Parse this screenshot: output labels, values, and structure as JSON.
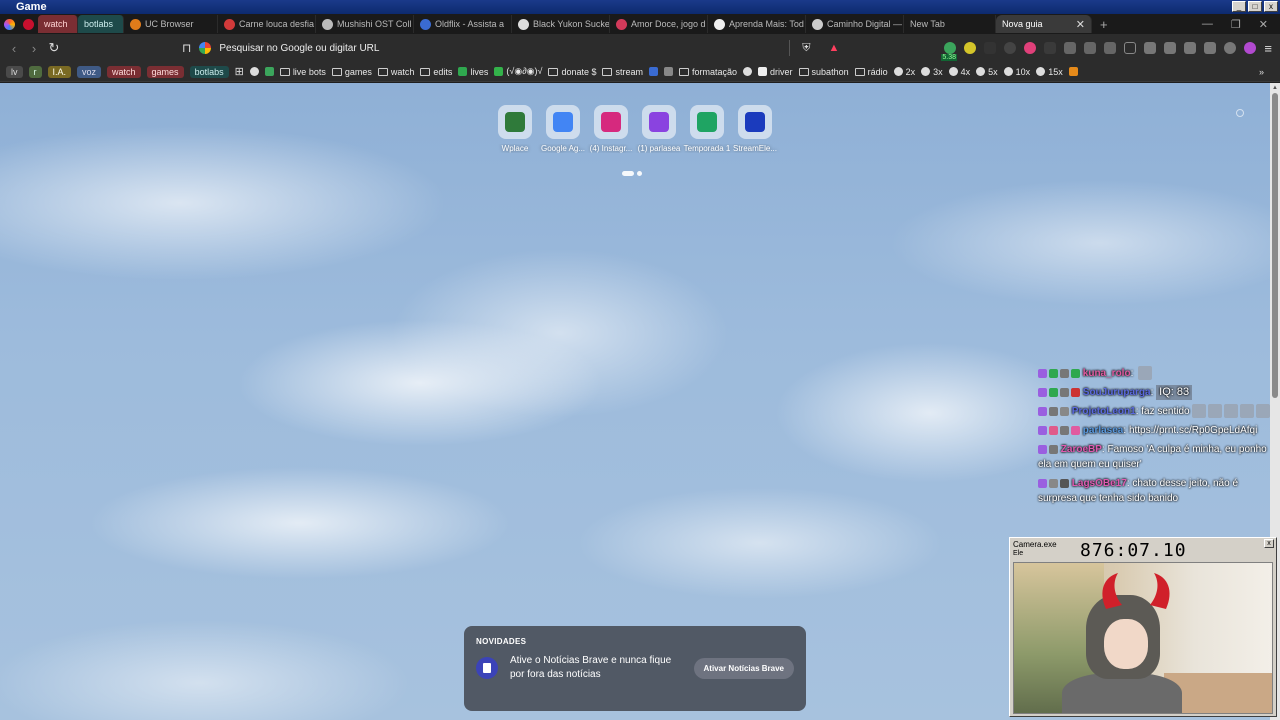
{
  "os": {
    "title": "Game",
    "controls": [
      "_",
      "□",
      "x"
    ]
  },
  "tabs": [
    {
      "label": "watch",
      "group": "watch",
      "favicon_color": "#7a2e33"
    },
    {
      "label": "botlabs",
      "group": "botlabs",
      "favicon_color": "#1e4a4a"
    },
    {
      "label": "UC Browser",
      "favicon_color": "#e07b1a"
    },
    {
      "label": "Carne louca desfia",
      "favicon_color": "#d23a3a"
    },
    {
      "label": "Mushishi OST Coll",
      "favicon_color": "#bbbbbb"
    },
    {
      "label": "Oldflix - Assista a",
      "favicon_color": "#3a6bd2"
    },
    {
      "label": "Black Yukon Sucke",
      "favicon_color": "#dddddd"
    },
    {
      "label": "Amor Doce, jogo d",
      "favicon_color": "#d23a5a"
    },
    {
      "label": "Aprenda Mais: Tod",
      "favicon_color": "#eeeeee"
    },
    {
      "label": "Caminho Digital —",
      "favicon_color": "#cccccc"
    },
    {
      "label": "New Tab",
      "favicon_color": ""
    },
    {
      "label": "Nova guia",
      "favicon_color": "",
      "active": true
    }
  ],
  "tab_close": "✕",
  "new_tab": "+",
  "window_controls": [
    "—",
    "❐",
    "✕"
  ],
  "toolbar": {
    "back": "‹",
    "forward": "›",
    "reload": "↻",
    "search_placeholder": "Pesquisar no Google ou digitar URL",
    "menu": "≡",
    "extension_badge": "5.38"
  },
  "bookmarks": [
    {
      "label": "lv",
      "type": "chip",
      "color": "gray"
    },
    {
      "label": "r",
      "type": "chip",
      "color": "green"
    },
    {
      "label": "I.A.",
      "type": "chip",
      "color": "yellow"
    },
    {
      "label": "voz",
      "type": "chip",
      "color": "blue"
    },
    {
      "label": "watch",
      "type": "chip",
      "color": "red"
    },
    {
      "label": "games",
      "type": "chip",
      "color": "red"
    },
    {
      "label": "botlabs",
      "type": "chip",
      "color": "teal"
    },
    {
      "label": "",
      "type": "grid"
    },
    {
      "label": "",
      "type": "globe"
    },
    {
      "label": "",
      "type": "square",
      "color": "#3ba55c"
    },
    {
      "label": "live bots",
      "type": "folder"
    },
    {
      "label": "games",
      "type": "folder"
    },
    {
      "label": "watch",
      "type": "folder"
    },
    {
      "label": "edits",
      "type": "folder"
    },
    {
      "label": "lives",
      "type": "square",
      "color": "#2fa84f"
    },
    {
      "label": "(√◉∂◉)√",
      "type": "square",
      "color": "#33b24a"
    },
    {
      "label": "donate $",
      "type": "folder"
    },
    {
      "label": "stream",
      "type": "folder"
    },
    {
      "label": "",
      "type": "square",
      "color": "#3a6bd2"
    },
    {
      "label": "",
      "type": "square",
      "color": "#888888"
    },
    {
      "label": "formatação",
      "type": "folder"
    },
    {
      "label": "",
      "type": "globe"
    },
    {
      "label": "driver",
      "type": "square",
      "color": "#eeeeee"
    },
    {
      "label": "subathon",
      "type": "folder"
    },
    {
      "label": "rádio",
      "type": "folder"
    },
    {
      "label": "2x",
      "type": "globe"
    },
    {
      "label": "3x",
      "type": "globe"
    },
    {
      "label": "4x",
      "type": "globe"
    },
    {
      "label": "5x",
      "type": "globe"
    },
    {
      "label": "10x",
      "type": "globe"
    },
    {
      "label": "15x",
      "type": "globe"
    },
    {
      "label": "",
      "type": "square",
      "color": "#e58a1a"
    }
  ],
  "bookmarks_more": "»",
  "top_sites": [
    {
      "label": "Wplace",
      "color": "#2f7a3a"
    },
    {
      "label": "Google Ag...",
      "color": "#4285f4"
    },
    {
      "label": "(4) Instagr...",
      "color": "#d6297e"
    },
    {
      "label": "(1) parlasea",
      "color": "#8a43e0"
    },
    {
      "label": "Temporada 1",
      "color": "#1fa463"
    },
    {
      "label": "StreamEle...",
      "color": "#1b3bbd"
    }
  ],
  "chat": [
    {
      "name": "kuna_rolo",
      "name_color": "#e05aa0",
      "message": "",
      "badge_colors": [
        "#9a5fe0",
        "#2fa84f",
        "#777777",
        "#2fa84f"
      ],
      "emote_count": 1
    },
    {
      "name": "SouJuruparga",
      "name_color": "#5a6adf",
      "message": "",
      "badge_colors": [
        "#9a5fe0",
        "#2fa84f",
        "#777777",
        "#c33"
      ],
      "iq": "IQ: 83"
    },
    {
      "name": "ProjetoLeon1",
      "name_color": "#5a6adf",
      "message": "faz sentido",
      "badge_colors": [
        "#9a5fe0",
        "#777777",
        "#888888"
      ],
      "emote_count": 5
    },
    {
      "name": "parlasea",
      "name_color": "#5a9adf",
      "message": "https://prnt.sc/Rp0GpeLdAfqi",
      "badge_colors": [
        "#9a5fe0",
        "#e05a8a",
        "#777777",
        "#e05aa0"
      ]
    },
    {
      "name": "ZaroeBP",
      "name_color": "#df5ab0",
      "message": "Famoso 'A culpa é minha, eu ponho ela em quem eu quiser'",
      "badge_colors": [
        "#9a5fe0",
        "#777777"
      ]
    },
    {
      "name": "LagsOBe17",
      "name_color": "#df5ab0",
      "message": "chato desse jeito, não é surpresa que tenha sido banido",
      "badge_colors": [
        "#9a5fe0",
        "#888888",
        "#555555"
      ]
    }
  ],
  "camera": {
    "title": "Camera.exe",
    "timer": "876:07.10",
    "menu": "Ele",
    "close": "x"
  },
  "news": {
    "header": "NOVIDADES",
    "text": "Ative o Notícias Brave e nunca fique por fora das notícias",
    "button": "Ativar Notícias Brave"
  }
}
